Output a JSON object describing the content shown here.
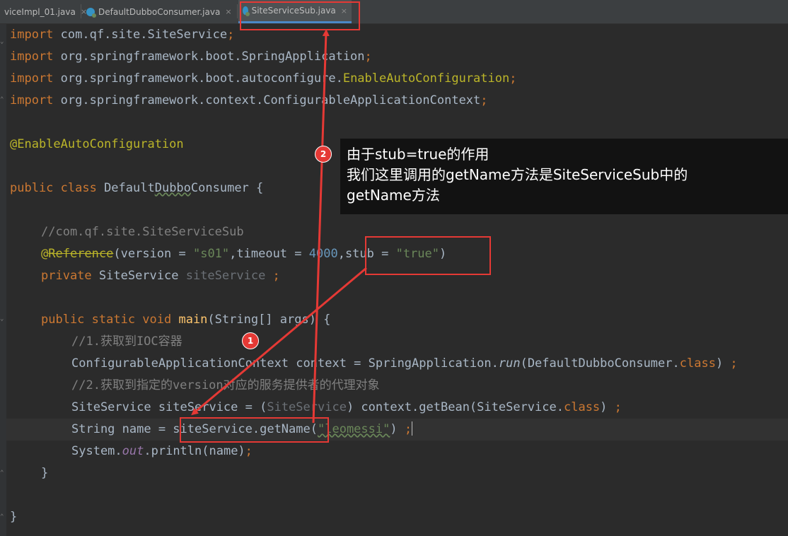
{
  "tabs": [
    {
      "label": "viceImpl_01.java",
      "close": "×"
    },
    {
      "label": "DefaultDubboConsumer.java",
      "close": "×"
    },
    {
      "label": "SiteServiceSub.java",
      "close": "×"
    }
  ],
  "code": {
    "l1_kw": "import",
    "l1_rest": " com.qf.site.SiteService",
    "l1_semi": ";",
    "l2_kw": "import",
    "l2_rest": " org.springframework.boot.SpringApplication",
    "l2_semi": ";",
    "l3_kw": "import",
    "l3_rest": " org.springframework.boot.autoconfigure.",
    "l3_ann": "EnableAutoConfiguration",
    "l3_semi": ";",
    "l4_kw": "import",
    "l4_rest": " org.springframework.context.ConfigurableApplicationContext",
    "l4_semi": ";",
    "l5_ann": "@EnableAutoConfiguration",
    "l6_kw": "public class",
    "l6_rest1": " Default",
    "l6_wavy": "Dubbo",
    "l6_rest2": "Consumer {",
    "l7_comment": "//com.qf.site.SiteServiceSub",
    "l8_at": "@",
    "l8_ref": "Reference",
    "l8_p1": "(version = ",
    "l8_s1": "\"s01\"",
    "l8_p2": ",timeout = ",
    "l8_num": "4000",
    "l8_p3": ",stub = ",
    "l8_s2": "\"true\"",
    "l8_p4": ")",
    "l9_kw": "private",
    "l9_type": " SiteService ",
    "l9_var": "siteService",
    "l9_semi": " ;",
    "l10_kw": "public static void",
    "l10_fn": " main",
    "l10_rest": "(String[] args) {",
    "l11_comment": "//1.获取到IOC容器",
    "l12_p1": "ConfigurableApplicationContext context = SpringApplication.",
    "l12_run": "run",
    "l12_p2": "(DefaultDubboConsumer.",
    "l12_cls": "class",
    "l12_p3": ") ",
    "l12_semi": ";",
    "l13_comment": "//2.获取到指定的version对应的服务提供者的代理对象",
    "l14_p1": "SiteService siteService = (",
    "l14_dim": "SiteService",
    "l14_p2": ") context.getBean(SiteService.",
    "l14_cls": "class",
    "l14_p3": ") ",
    "l14_semi": ";",
    "l15_p1": "String name = siteService.getName(",
    "l15_str": "\"leomessi\"",
    "l15_p2": ") ",
    "l15_semi": ";",
    "l16_p1": "System.",
    "l16_out": "out",
    "l16_p2": ".println(name)",
    "l16_semi": ";",
    "l17": "}",
    "l18": "}"
  },
  "annotations": {
    "badge1": "1",
    "badge2": "2",
    "callout_line1": "由于stub=true的作用",
    "callout_line2": "我们这里调用的getName方法是SiteServiceSub中的",
    "callout_line3": "getName方法"
  },
  "colors": {
    "background": "#2b2b2b",
    "keyword": "#cc7832",
    "string": "#6a8759",
    "number": "#6897bb",
    "comment": "#808080",
    "annotation": "#bbb529",
    "highlight_red": "#e53935"
  }
}
